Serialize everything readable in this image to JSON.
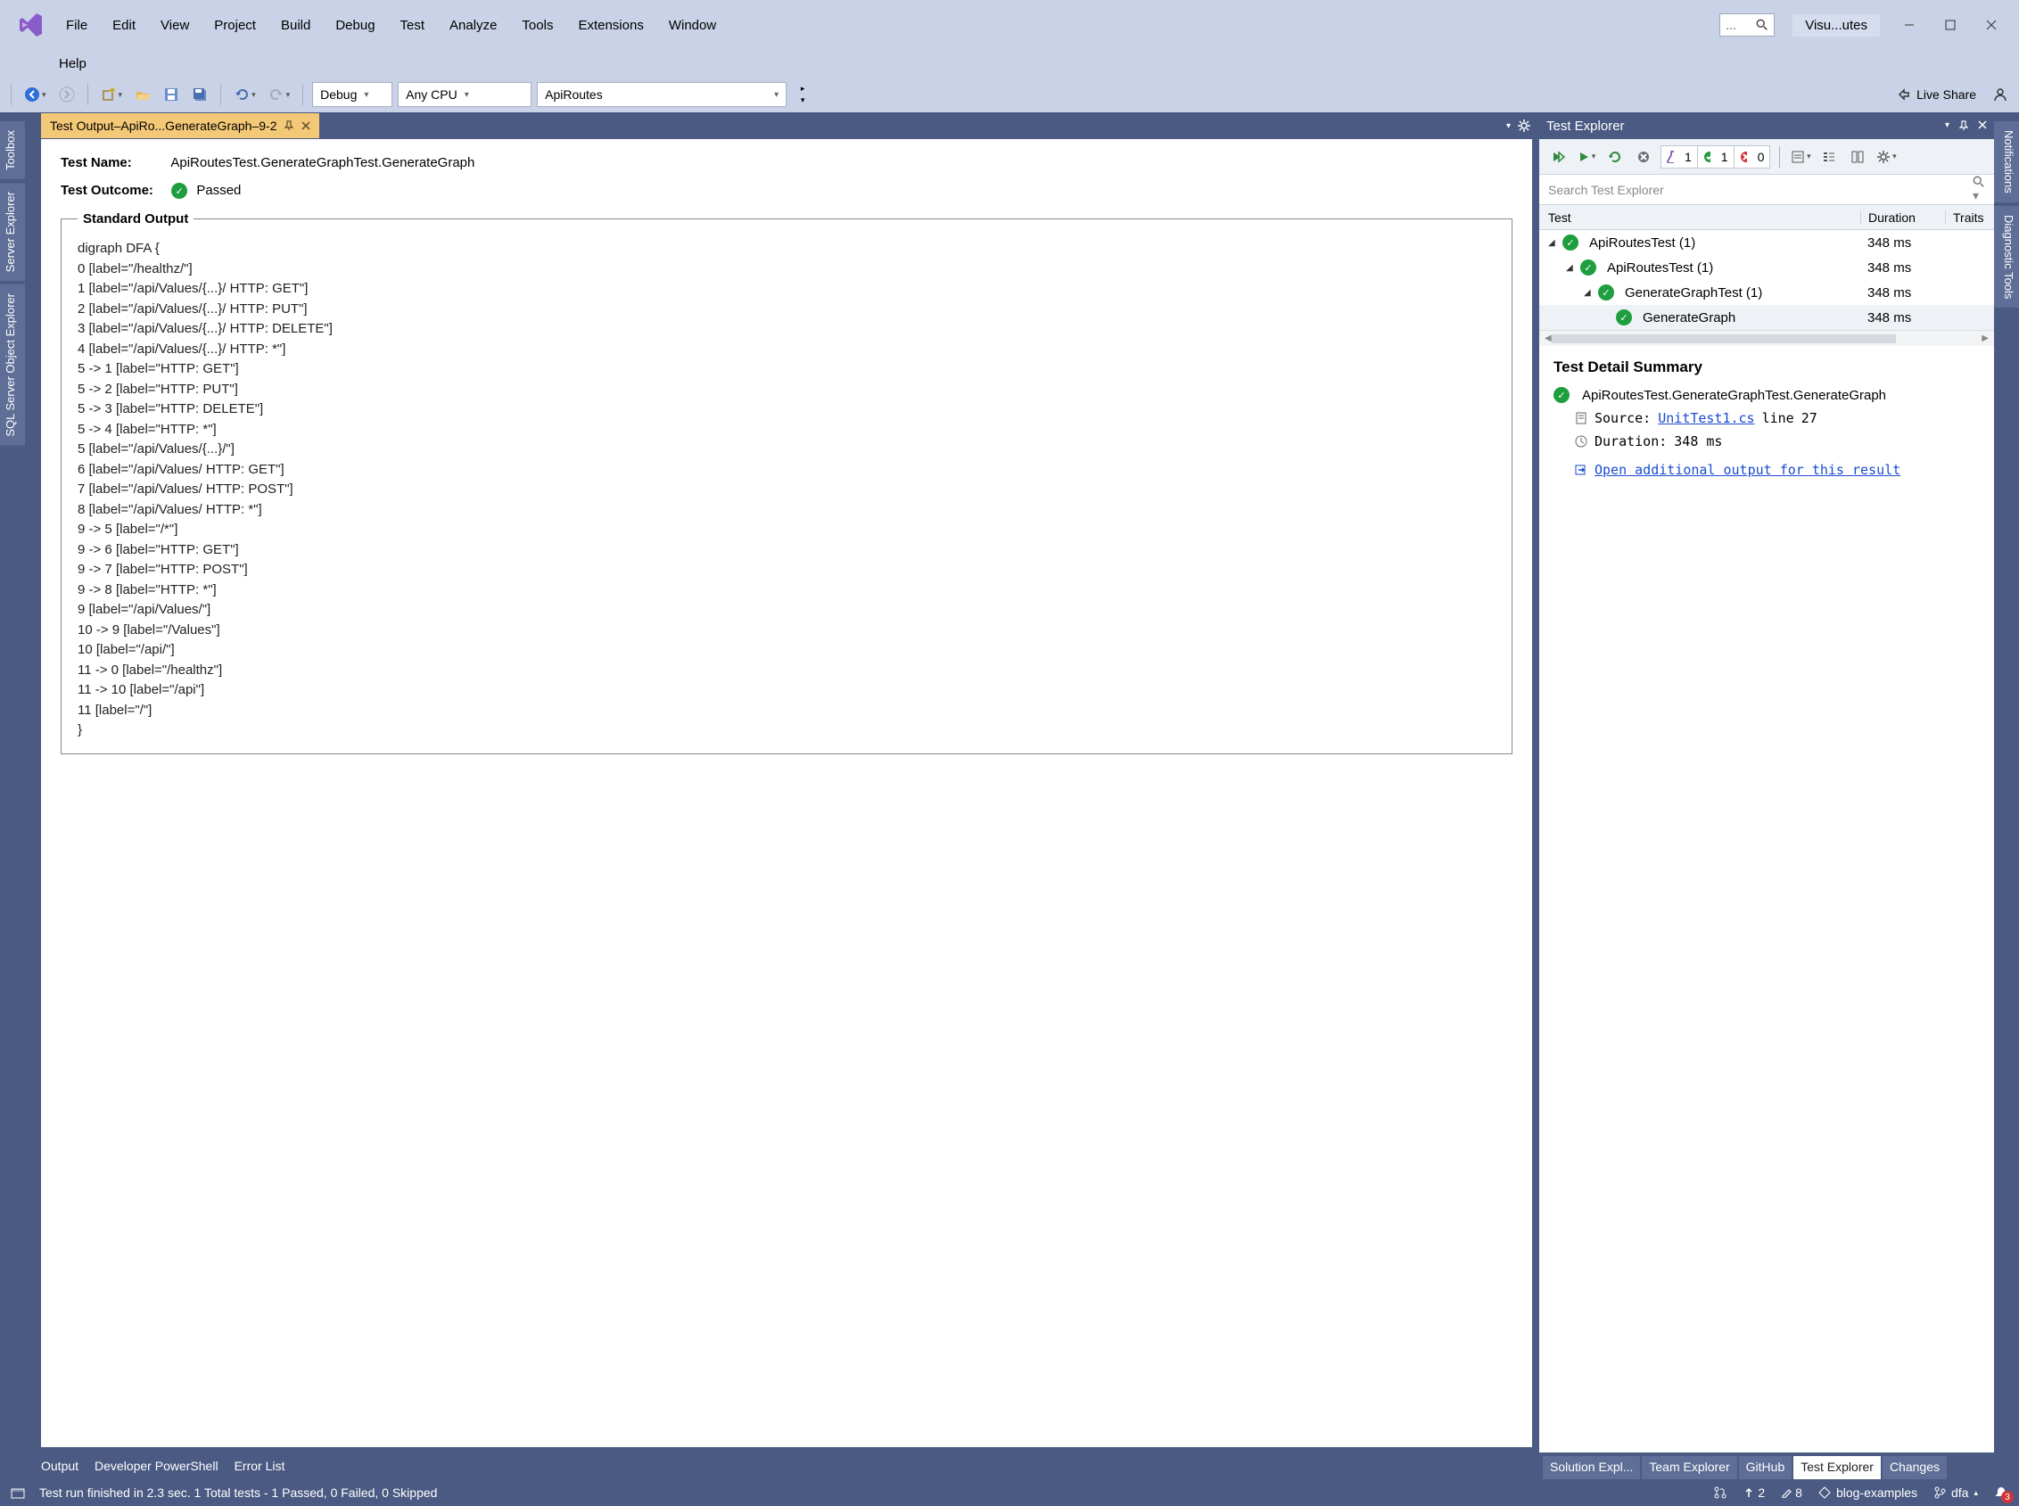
{
  "app_title": "Visu...utes",
  "menu": {
    "items": [
      "File",
      "Edit",
      "View",
      "Project",
      "Build",
      "Debug",
      "Test",
      "Analyze",
      "Tools",
      "Extensions",
      "Window"
    ],
    "help": "Help"
  },
  "toolbar": {
    "config": "Debug",
    "platform": "Any CPU",
    "startup": "ApiRoutes",
    "live_share": "Live Share"
  },
  "left_tabs": [
    "Toolbox",
    "Server Explorer",
    "SQL Server Object Explorer"
  ],
  "right_tabs": [
    "Notifications",
    "Diagnostic Tools"
  ],
  "document": {
    "tab_title": "Test Output–ApiRo...GenerateGraph–9-2",
    "test_name_label": "Test Name:",
    "test_name_value": "ApiRoutesTest.GenerateGraphTest.GenerateGraph",
    "test_outcome_label": "Test Outcome:",
    "test_outcome_value": "Passed",
    "std_output_legend": "Standard Output",
    "std_output_text": "digraph DFA {\n0 [label=\"/healthz/\"]\n1 [label=\"/api/Values/{...}/ HTTP: GET\"]\n2 [label=\"/api/Values/{...}/ HTTP: PUT\"]\n3 [label=\"/api/Values/{...}/ HTTP: DELETE\"]\n4 [label=\"/api/Values/{...}/ HTTP: *\"]\n5 -> 1 [label=\"HTTP: GET\"]\n5 -> 2 [label=\"HTTP: PUT\"]\n5 -> 3 [label=\"HTTP: DELETE\"]\n5 -> 4 [label=\"HTTP: *\"]\n5 [label=\"/api/Values/{...}/\"]\n6 [label=\"/api/Values/ HTTP: GET\"]\n7 [label=\"/api/Values/ HTTP: POST\"]\n8 [label=\"/api/Values/ HTTP: *\"]\n9 -> 5 [label=\"/*\"]\n9 -> 6 [label=\"HTTP: GET\"]\n9 -> 7 [label=\"HTTP: POST\"]\n9 -> 8 [label=\"HTTP: *\"]\n9 [label=\"/api/Values/\"]\n10 -> 9 [label=\"/Values\"]\n10 [label=\"/api/\"]\n11 -> 0 [label=\"/healthz\"]\n11 -> 10 [label=\"/api\"]\n11 [label=\"/\"]\n}"
  },
  "bottom_tabs": [
    "Output",
    "Developer PowerShell",
    "Error List"
  ],
  "test_explorer": {
    "title": "Test Explorer",
    "search_placeholder": "Search Test Explorer",
    "counters": {
      "flask": "1",
      "pass": "1",
      "fail": "0"
    },
    "columns": {
      "test": "Test",
      "duration": "Duration",
      "traits": "Traits"
    },
    "tree": [
      {
        "indent": 0,
        "name": "ApiRoutesTest (1)",
        "duration": "348 ms",
        "expanded": true
      },
      {
        "indent": 1,
        "name": "ApiRoutesTest (1)",
        "duration": "348 ms",
        "expanded": true
      },
      {
        "indent": 2,
        "name": "GenerateGraphTest (1)",
        "duration": "348 ms",
        "expanded": true
      },
      {
        "indent": 3,
        "name": "GenerateGraph",
        "duration": "348 ms",
        "leaf": true,
        "selected": true
      }
    ],
    "detail": {
      "heading": "Test Detail Summary",
      "title": "ApiRoutesTest.GenerateGraphTest.GenerateGraph",
      "source_label": "Source:",
      "source_file": "UnitTest1.cs",
      "source_line_label": "line",
      "source_line": "27",
      "duration_label": "Duration:",
      "duration_value": "348 ms",
      "open_link": "Open additional output for this result"
    },
    "bottom_tabs": [
      "Solution Expl...",
      "Team Explorer",
      "GitHub",
      "Test Explorer",
      "Changes"
    ],
    "active_tab": 3
  },
  "status": {
    "left_icon_tooltip": "Test run",
    "message": "Test run finished in 2.3 sec. 1 Total tests - 1 Passed, 0 Failed, 0 Skipped",
    "up_count": "2",
    "pencil_count": "8",
    "repo": "blog-examples",
    "branch": "dfa",
    "notif_count": "3"
  }
}
